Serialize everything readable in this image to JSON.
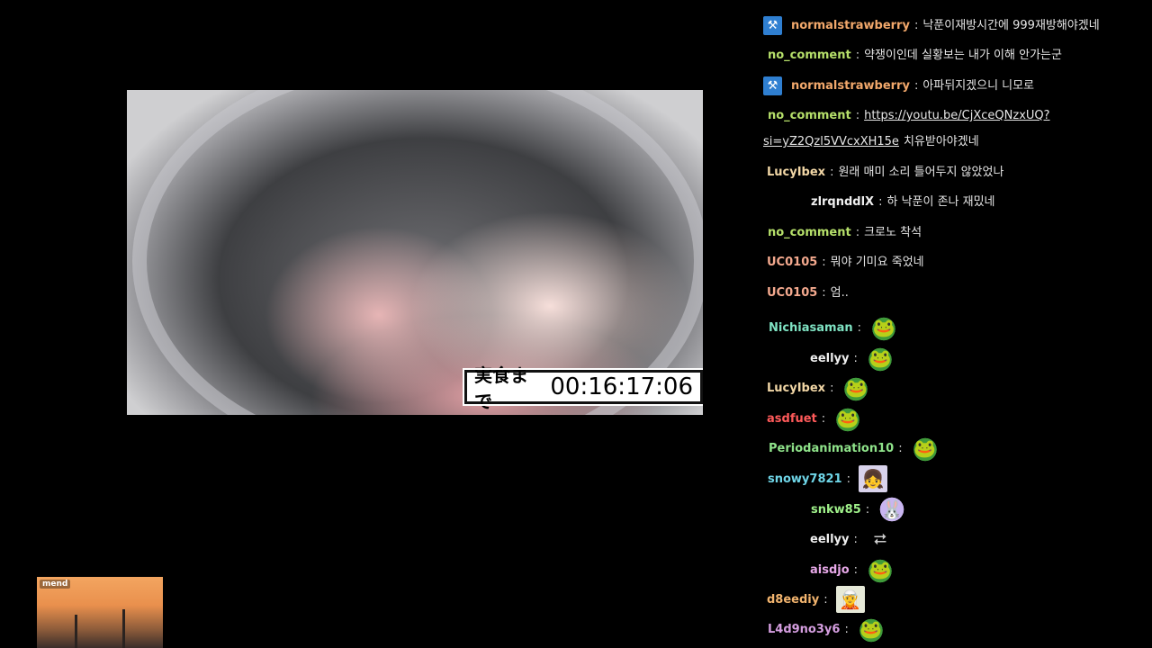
{
  "video": {
    "timer_label": "実食まで",
    "timer_value": "00:16:17:06"
  },
  "thumbnail": {
    "tag": "mend"
  },
  "chat": [
    {
      "badge": "hammer-icon",
      "user": "normalstrawberry",
      "color": "#f2a86b",
      "text": "낙푼이재방시간에 999재방해야겠네"
    },
    {
      "user": "no_comment",
      "color": "#b6e06a",
      "text": "약쟁이인데 실황보는 내가 이해 안가는군"
    },
    {
      "badge": "hammer-icon",
      "user": "normalstrawberry",
      "color": "#f2a86b",
      "text": "아파뒤지겠으니 니모로"
    },
    {
      "user": "no_comment",
      "color": "#b6e06a",
      "link": "https://youtu.be/CjXceQNzxUQ?",
      "link2": "si=yZ2Qzl5VVcxXH15e",
      "text": "치유받아야겠네"
    },
    {
      "user": "LucyIbex",
      "color": "#f2d7a6",
      "text": "원래 매미 소리 틀어두지 않았었나"
    },
    {
      "user": "zlrqnddlX",
      "color": "#f0f0f0",
      "text": "하 낙푼이 존나 재밌네"
    },
    {
      "user": "no_comment",
      "color": "#b6e06a",
      "text": "크로노 착석"
    },
    {
      "user": "UC0105",
      "color": "#f4a98e",
      "text": "뭐야 기미요 죽었네"
    },
    {
      "user": "UC0105",
      "color": "#f4a98e",
      "text": "엄.."
    },
    {
      "user": "Nichiasaman",
      "color": "#7fe3c3",
      "emote": "frog-emote"
    },
    {
      "user": "eellyy",
      "color": "#f0f0f0",
      "emote": "frog-emote"
    },
    {
      "user": "LucyIbex",
      "color": "#f2d7a6",
      "emote": "frog-emote"
    },
    {
      "user": "asdfuet",
      "color": "#ff5a5a",
      "emote": "frog-emote"
    },
    {
      "user": "Periodanimation10",
      "color": "#8fe38a",
      "emote": "frog-emote"
    },
    {
      "user": "snowy7821",
      "color": "#6fd6e8",
      "emote": "anime-emote"
    },
    {
      "user": "snkw85",
      "color": "#9ff08a",
      "emote": "purple-emote"
    },
    {
      "user": "eellyy",
      "color": "#f0f0f0",
      "emote": "arrow-emote"
    },
    {
      "user": "aisdjo",
      "color": "#e7a8e8",
      "emote": "frog-emote"
    },
    {
      "user": "d8eediy",
      "color": "#f2b46e",
      "emote": "girl-emote"
    },
    {
      "user": "L4d9no3y6",
      "color": "#d59ee0",
      "emote": "frog-emote"
    }
  ]
}
